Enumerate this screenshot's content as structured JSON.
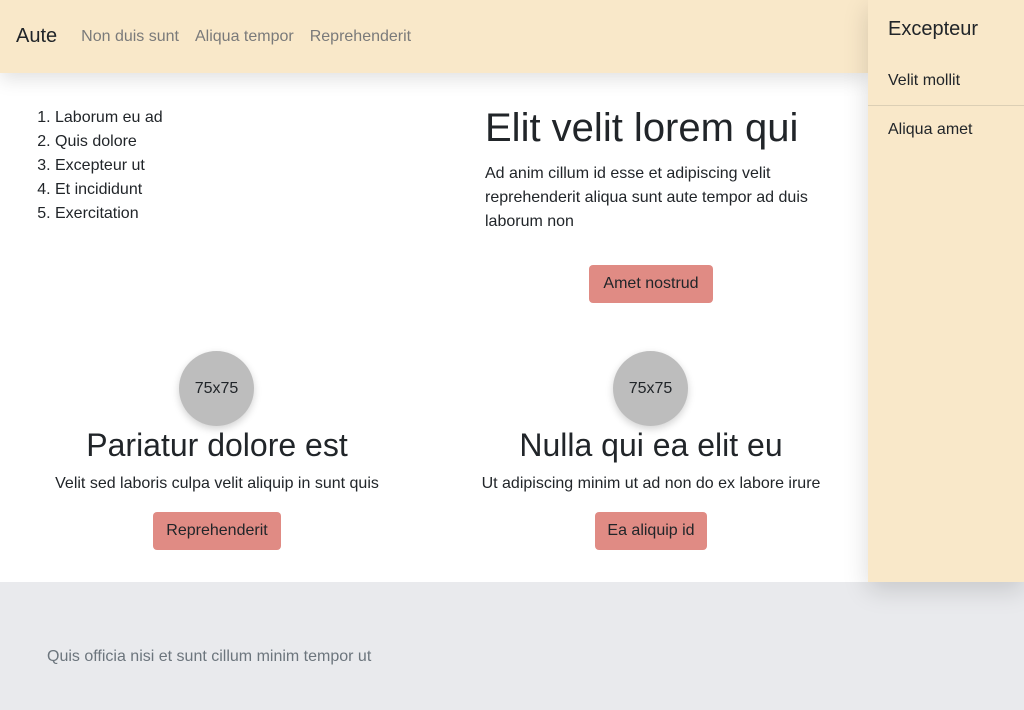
{
  "navbar": {
    "brand": "Aute",
    "links": [
      "Non duis sunt",
      "Aliqua tempor",
      "Reprehenderit"
    ]
  },
  "sidebar": {
    "title": "Excepteur",
    "items": [
      "Velit mollit",
      "Aliqua amet"
    ]
  },
  "list": {
    "items": [
      "Laborum eu ad",
      "Quis dolore",
      "Excepteur ut",
      "Et incididunt",
      "Exercitation"
    ]
  },
  "hero": {
    "title": "Elit velit lorem qui",
    "text": "Ad anim cillum id esse et adipiscing velit reprehenderit aliqua sunt aute tempor ad duis laborum non",
    "button": "Amet nostrud"
  },
  "cards": [
    {
      "avatar": "75x75",
      "title": "Pariatur dolore est",
      "text": "Velit sed laboris culpa velit aliquip in sunt quis",
      "button": "Reprehenderit"
    },
    {
      "avatar": "75x75",
      "title": "Nulla qui ea elit eu",
      "text": "Ut adipiscing minim ut ad non do ex labore irure",
      "button": "Ea aliquip id"
    }
  ],
  "footer": {
    "text": "Quis officia nisi et sunt cillum minim tempor ut"
  },
  "colors": {
    "navbar_bg": "#f9e8c9",
    "button_bg": "#e08b84",
    "footer_bg": "#e9eaed",
    "avatar_bg": "#bdbdbd"
  }
}
